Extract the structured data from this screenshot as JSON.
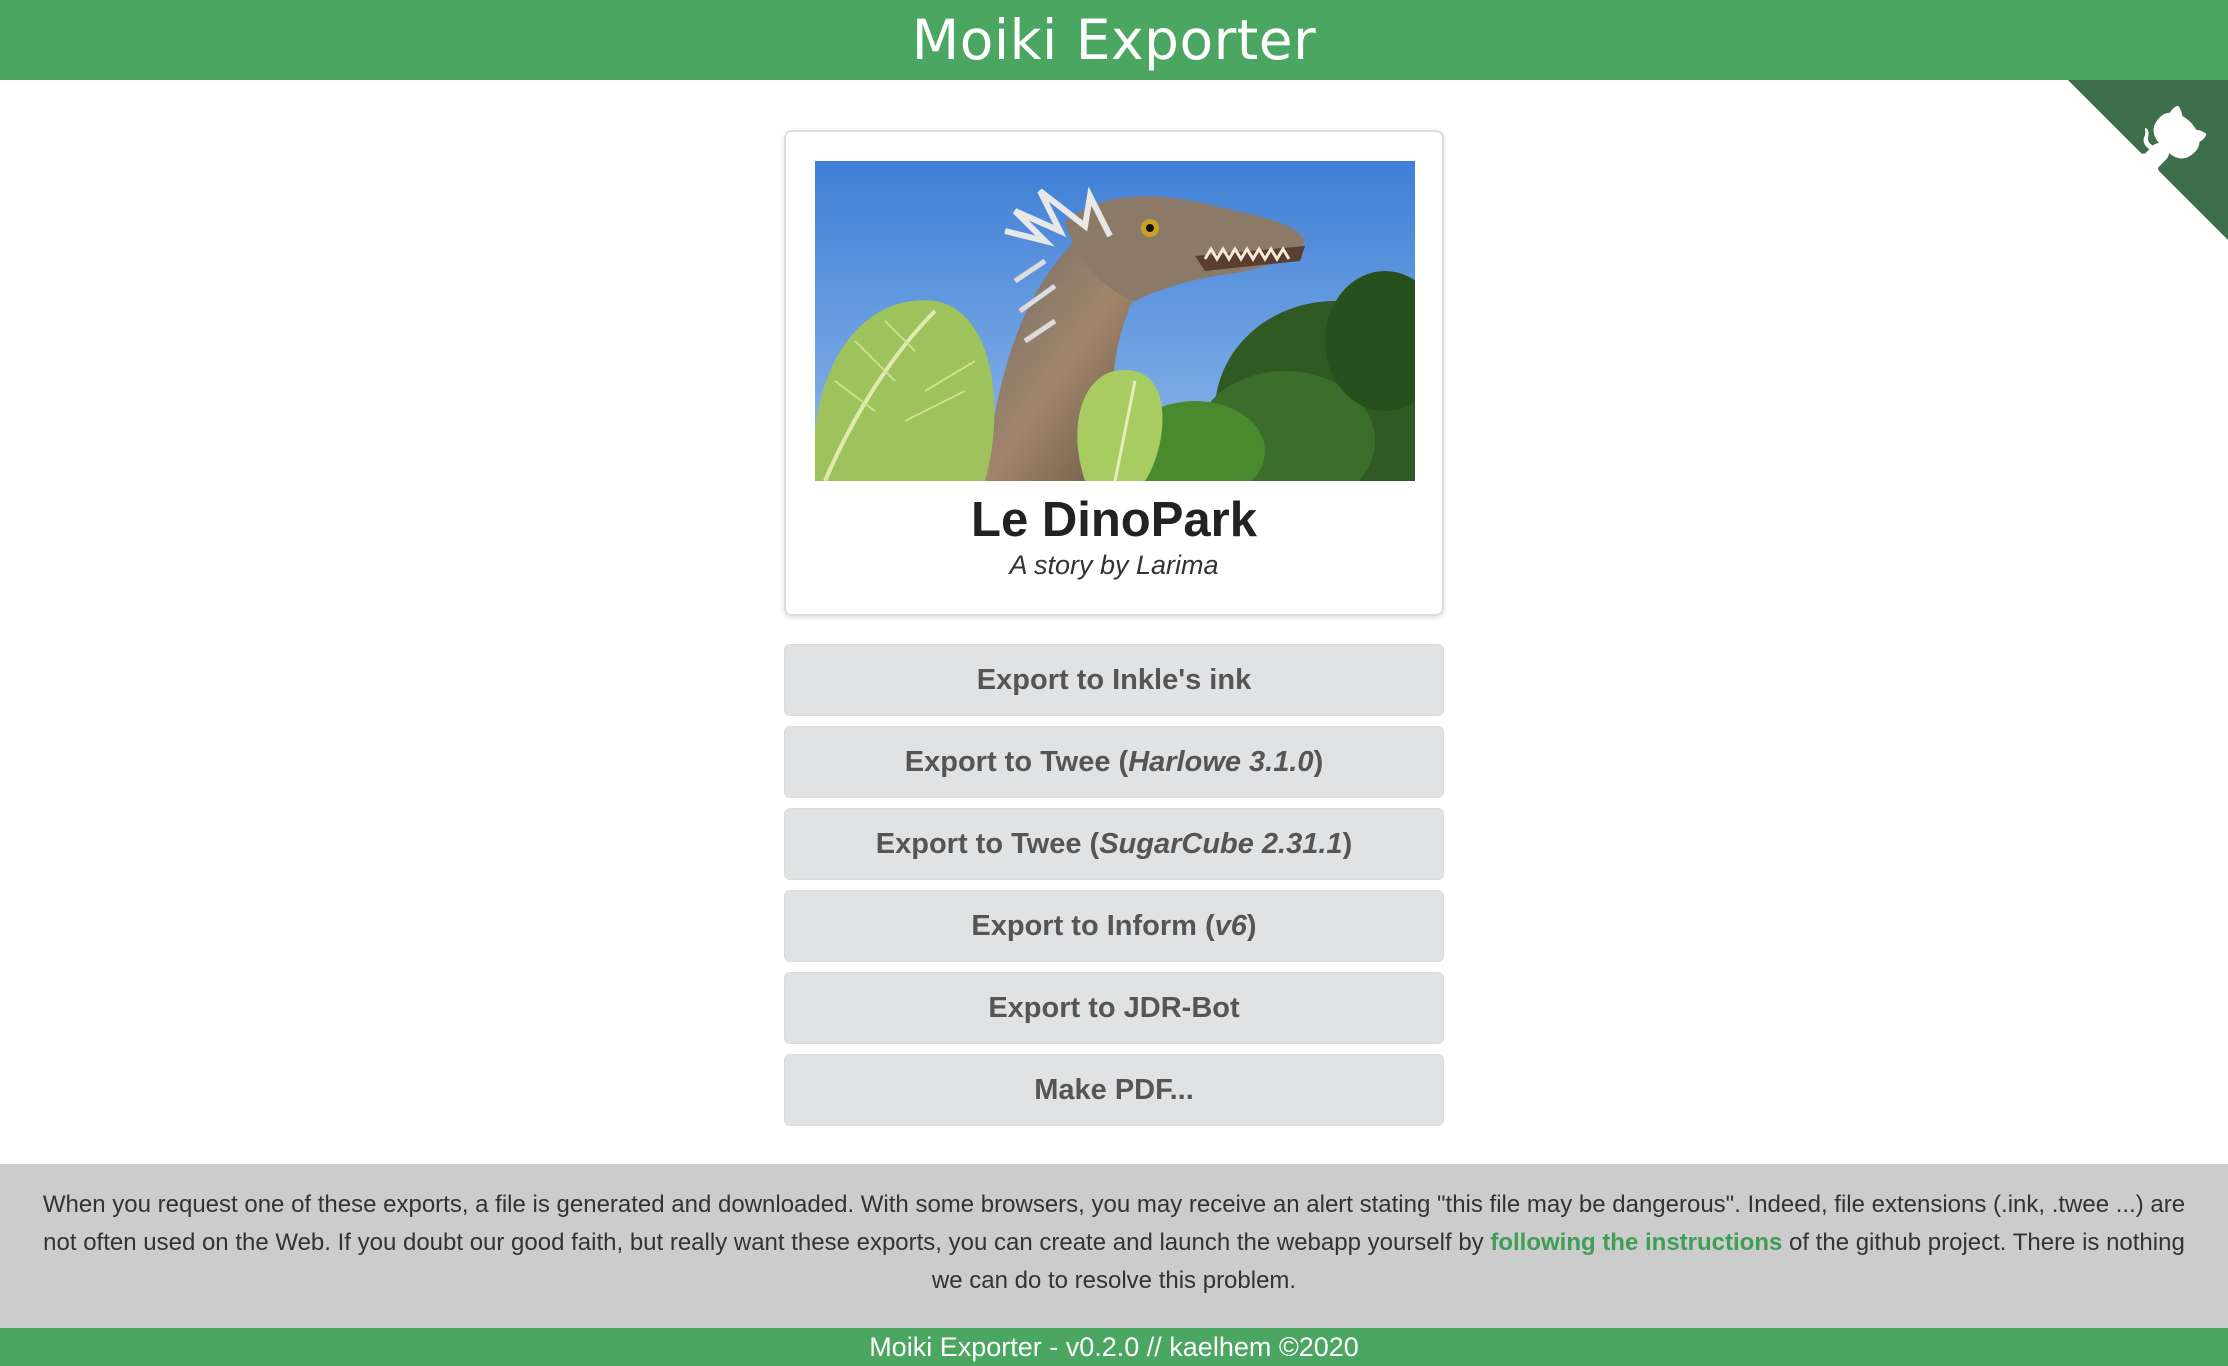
{
  "header": {
    "title": "Moiki Exporter"
  },
  "github_corner": {
    "icon": "octocat-icon",
    "color": "#3e6e4a"
  },
  "story": {
    "title": "Le DinoPark",
    "author": "A story by Larima",
    "cover_alt": "dinosaur cover illustration"
  },
  "exports": [
    {
      "prefix": "Export to Inkle's ink",
      "emph": "",
      "suffix": ""
    },
    {
      "prefix": "Export to Twee (",
      "emph": "Harlowe 3.1.0",
      "suffix": ")"
    },
    {
      "prefix": "Export to Twee (",
      "emph": "SugarCube 2.31.1",
      "suffix": ")"
    },
    {
      "prefix": "Export to Inform (",
      "emph": "v6",
      "suffix": ")"
    },
    {
      "prefix": "Export to JDR-Bot",
      "emph": "",
      "suffix": ""
    },
    {
      "prefix": "Make PDF...",
      "emph": "",
      "suffix": ""
    }
  ],
  "notice": {
    "before": "When you request one of these exports, a file is generated and downloaded. With some browsers, you may receive an alert stating \"this file may be dangerous\". Indeed, file extensions (.ink, .twee ...) are not often used on the Web. If you doubt our good faith, but really want these exports, you can create and launch the webapp yourself by ",
    "link": "following the instructions",
    "after": " of the github project. There is nothing we can do to resolve this problem."
  },
  "footer": {
    "text": "Moiki Exporter - v0.2.0 // kaelhem ©2020"
  },
  "colors": {
    "brand": "#4aa660",
    "button_bg": "#e1e2e4",
    "notice_bg": "#cccccc"
  }
}
